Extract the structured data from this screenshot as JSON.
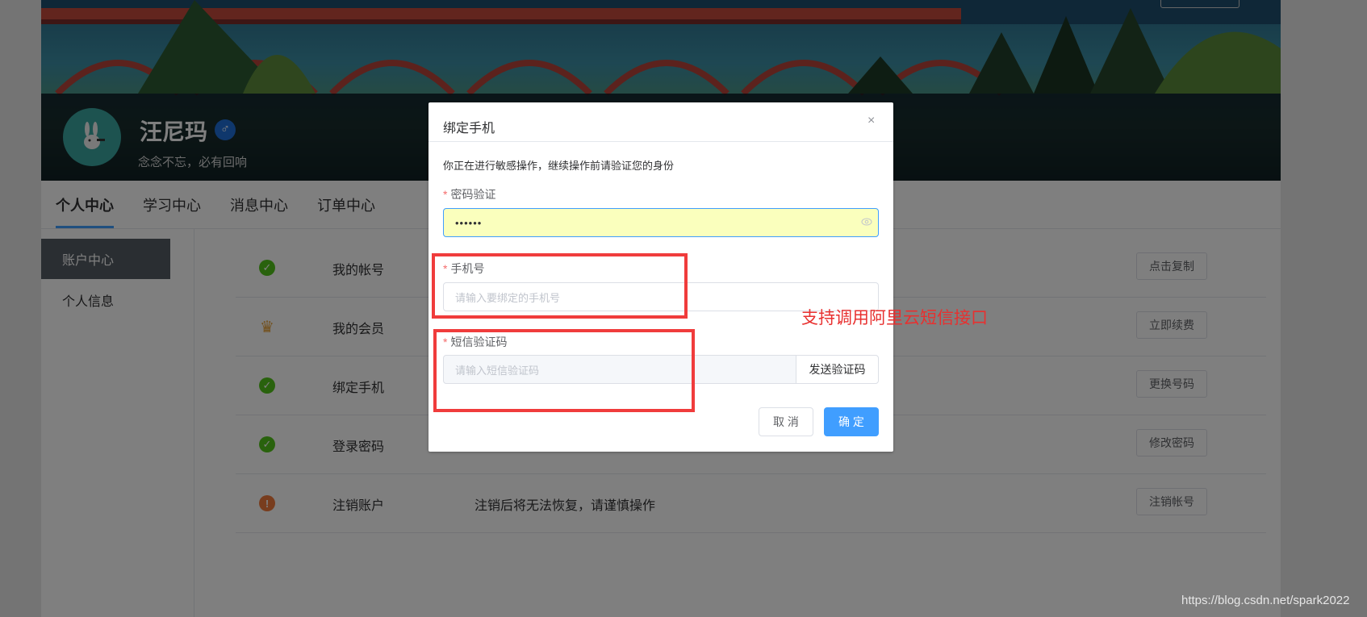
{
  "profile": {
    "username": "汪尼玛",
    "gender_symbol": "♂",
    "motto": "念念不忘，必有回响"
  },
  "tabs": [
    {
      "label": "个人中心",
      "active": true
    },
    {
      "label": "学习中心",
      "active": false
    },
    {
      "label": "消息中心",
      "active": false
    },
    {
      "label": "订单中心",
      "active": false
    }
  ],
  "sidebar": {
    "active": "账户中心",
    "items": [
      "个人信息"
    ]
  },
  "rows": [
    {
      "icon": "check-circle-icon",
      "icon_char": "✓",
      "icon_color": "#52c41a",
      "label": "我的帐号",
      "desc": "",
      "button": "点击复制"
    },
    {
      "icon": "crown-icon",
      "icon_char": "♛",
      "icon_color": "#e6a23c",
      "label": "我的会员",
      "desc": "",
      "button": "立即续费"
    },
    {
      "icon": "check-circle-icon",
      "icon_char": "✓",
      "icon_color": "#52c41a",
      "label": "绑定手机",
      "desc": "",
      "button": "更换号码"
    },
    {
      "icon": "check-circle-icon",
      "icon_char": "✓",
      "icon_color": "#52c41a",
      "label": "登录密码",
      "desc": "",
      "button": "修改密码"
    },
    {
      "icon": "warning-circle-icon",
      "icon_char": "!",
      "icon_color": "#f07a3c",
      "label": "注销账户",
      "desc": "注销后将无法恢复，请谨慎操作",
      "button": "注销帐号"
    }
  ],
  "dialog": {
    "title": "绑定手机",
    "close": "×",
    "tip": "你正在进行敏感操作，继续操作前请验证您的身份",
    "password_label": "密码验证",
    "password_value": "••••••",
    "phone_label": "手机号",
    "phone_placeholder": "请输入要绑定的手机号",
    "sms_label": "短信验证码",
    "sms_placeholder": "请输入短信验证码",
    "send_code": "发送验证码",
    "cancel": "取 消",
    "confirm": "确 定",
    "required_mark": "*"
  },
  "annotation": "支持调用阿里云短信接口",
  "watermark": "https://blog.csdn.net/spark2022",
  "colors": {
    "primary": "#409eff",
    "highlight_red": "#f03c3c",
    "autofill_yellow": "#faffbd"
  }
}
